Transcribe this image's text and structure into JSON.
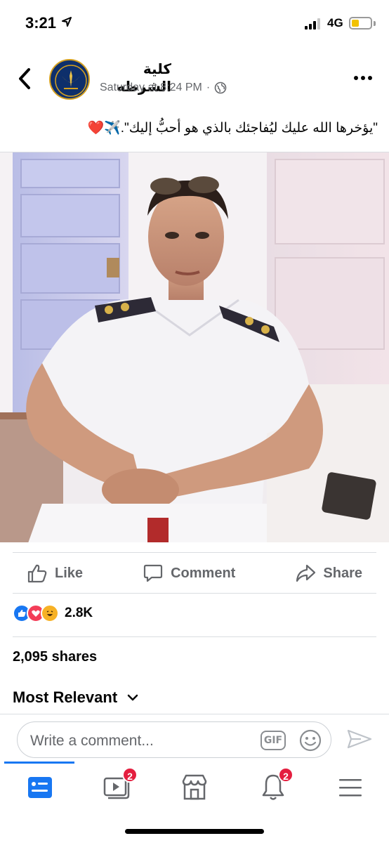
{
  "status_bar": {
    "time": "3:21",
    "network": "4G"
  },
  "post": {
    "page_name": "كلية الشرطه",
    "timestamp": "Saturday at 8:24 PM",
    "meta_separator": "·",
    "caption": "\"يؤخرها الله عليك ليُفاجئك بالذي هو أحبُّ إليك\".✈️❤️"
  },
  "actions": {
    "like": "Like",
    "comment": "Comment",
    "share": "Share"
  },
  "stats": {
    "reaction_count": "2.8K",
    "shares": "2,095 shares"
  },
  "comments": {
    "sort_label": "Most Relevant",
    "placeholder": "Write a comment...",
    "gif_label": "GIF"
  },
  "bottom_nav": {
    "watch_badge": "2",
    "notifications_badge": "2"
  },
  "colors": {
    "accent": "#1877f2",
    "badge": "#e41e3f",
    "muted": "#65676b"
  }
}
